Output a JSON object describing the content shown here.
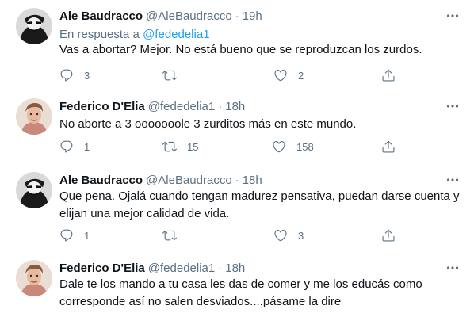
{
  "tweets": [
    {
      "name": "Ale Baudracco",
      "handle": "@AleBaudracco",
      "time": "19h",
      "reply_prefix": "En respuesta a",
      "reply_mention": "@fededelia1",
      "text": "Vas a abortar? Mejor. No está bueno que se reproduzcan los zurdos.",
      "replies": "3",
      "retweets": "",
      "likes": "2"
    },
    {
      "name": "Federico D'Elia",
      "handle": "@fededelia1",
      "time": "18h",
      "text": "No aborte a 3 ooooooole 3 zurditos más en este mundo.",
      "replies": "1",
      "retweets": "15",
      "likes": "158"
    },
    {
      "name": "Ale Baudracco",
      "handle": "@AleBaudracco",
      "time": "18h",
      "text": "Que pena. Ojalá cuando tengan madurez pensativa, puedan darse cuenta y elijan una mejor calidad de vida.",
      "replies": "1",
      "retweets": "",
      "likes": "3"
    },
    {
      "name": "Federico D'Elia",
      "handle": "@fededelia1",
      "time": "18h",
      "text": "Dale te los mando a tu casa les das de comer y me los educás como corresponde así no salen desviados....pásame la dire"
    }
  ],
  "separator": "·",
  "icons": {
    "reply": "reply-icon",
    "retweet": "retweet-icon",
    "like": "heart-icon",
    "share": "share-icon",
    "more": "more-icon"
  },
  "colors": {
    "secondary_text": "#5b7083",
    "link": "#1da1f2",
    "divider": "#e6ecf0"
  }
}
